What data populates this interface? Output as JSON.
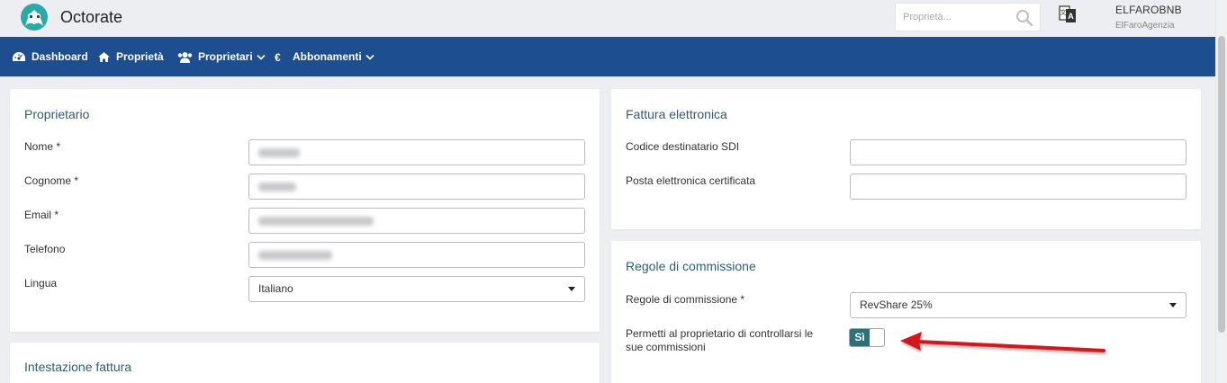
{
  "header": {
    "brand": "Octorate",
    "search": {
      "placeholder": "Proprietà..."
    },
    "user": {
      "name": "ELFAROBNB",
      "agency": "ElFaroAgenzia"
    }
  },
  "nav": {
    "items": [
      {
        "label": "Dashboard",
        "icon": "dashboard-icon"
      },
      {
        "label": "Proprietà",
        "icon": "home-icon"
      },
      {
        "label": "Proprietari",
        "icon": "users-icon",
        "dropdown": true
      },
      {
        "label": "Abbonamenti",
        "icon": "euro-icon",
        "dropdown": true
      }
    ]
  },
  "owner_panel": {
    "title": "Proprietario",
    "fields": [
      {
        "label": "Nome *"
      },
      {
        "label": "Cognome *"
      },
      {
        "label": "Email *"
      },
      {
        "label": "Telefono"
      },
      {
        "label": "Lingua",
        "value": "Italiano"
      }
    ]
  },
  "invoice_header_panel": {
    "title": "Intestazione fattura"
  },
  "einvoice_panel": {
    "title": "Fattura elettronica",
    "fields": [
      {
        "label": "Codice destinatario SDI",
        "value": ""
      },
      {
        "label": "Posta elettronica certificata",
        "value": ""
      }
    ]
  },
  "commission_panel": {
    "title": "Regole di commissione",
    "rule_label": "Regole di commissione *",
    "rule_value": "RevShare 25%",
    "permission_label": "Permetti al proprietario di controllarsi le sue commissioni",
    "toggle_label": "Sì"
  },
  "colors": {
    "navbar": "#1d4e8f",
    "panel_title": "#2f5f72",
    "toggle_on": "#2a7277",
    "annotation_arrow": "#d7191c"
  }
}
